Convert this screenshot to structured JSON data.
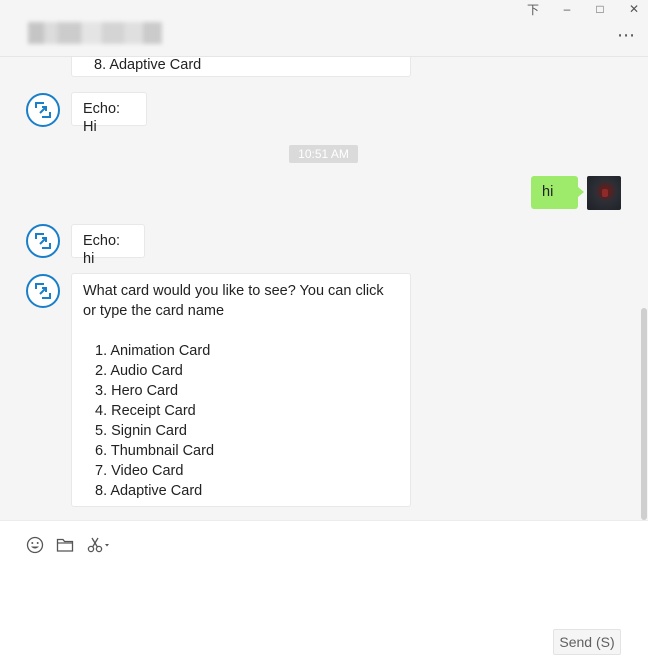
{
  "window": {
    "controls": {
      "pin": "下",
      "minimize": "–",
      "maximize": "□",
      "close": "✕"
    },
    "more_label": "⋯"
  },
  "messages": {
    "prev_last_item": "8. Adaptive Card",
    "echo1": "Echo: Hi",
    "timestamp": "10:51 AM",
    "user_msg": "hi",
    "echo2": "Echo: hi",
    "card_prompt_line1": "What card would you like to see? You can click",
    "card_prompt_line2": "or type the card name",
    "card_options": [
      "1. Animation Card",
      "2. Audio Card",
      "3. Hero Card",
      "4. Receipt Card",
      "5. Signin Card",
      "6. Thumbnail Card",
      "7. Video Card",
      "8. Adaptive Card"
    ]
  },
  "toolbar": {
    "icons": [
      "emoji-icon",
      "folder-icon",
      "scissors-icon"
    ]
  },
  "composer": {
    "value": ""
  },
  "send_label": "Send (S)"
}
